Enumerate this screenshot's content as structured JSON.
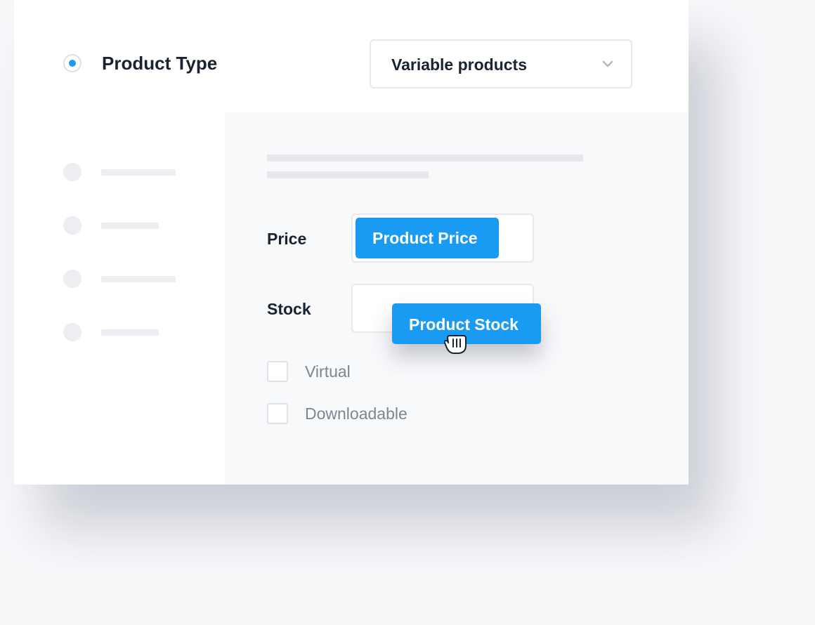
{
  "product_type": {
    "label": "Product Type",
    "selected_option": "Variable products"
  },
  "fields": {
    "price_label": "Price",
    "stock_label": "Stock"
  },
  "chips": {
    "price": "Product Price",
    "stock": "Product Stock"
  },
  "options": {
    "virtual": "Virtual",
    "downloadable": "Downloadable"
  },
  "colors": {
    "accent": "#1a9bf3",
    "text_dark": "#1a2330",
    "text_muted": "#7c8590",
    "placeholder": "#eceef1"
  },
  "icons": {
    "select_arrow": "chevron-down-icon",
    "drag_cursor": "grab-hand-icon"
  }
}
